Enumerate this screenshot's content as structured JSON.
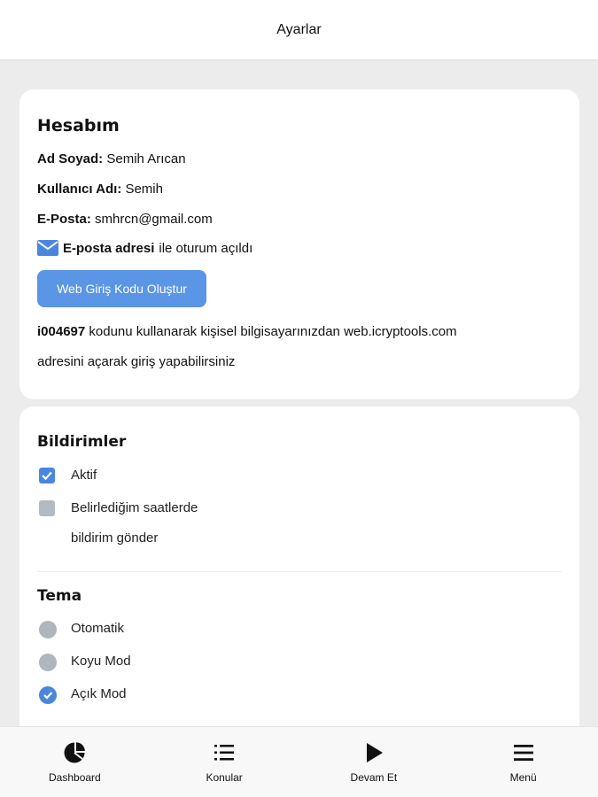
{
  "header": {
    "title": "Ayarlar"
  },
  "account": {
    "title": "Hesabım",
    "name_label": "Ad Soyad:",
    "name_value": "Semih Arıcan",
    "username_label": "Kullanıcı Adı:",
    "username_value": "Semih",
    "email_label": "E-Posta:",
    "email_value": "smhrcn@gmail.com",
    "login_method_bold": "E-posta adresi",
    "login_method_rest": "ile oturum açıldı",
    "web_code_button": "Web Giriş Kodu Oluştur",
    "code": "i004697",
    "code_text_1": "kodunu kullanarak kişisel bilgisayarınızdan web.icryptools.com",
    "code_text_2": "adresini açarak giriş yapabilirsiniz"
  },
  "notifications": {
    "title": "Bildirimler",
    "options": [
      {
        "label": "Aktif",
        "checked": true
      },
      {
        "label_line1": "Belirlediğim saatlerde",
        "label_line2": "bildirim gönder",
        "checked": false
      }
    ]
  },
  "theme": {
    "title": "Tema",
    "options": [
      {
        "label": "Otomatik",
        "selected": false
      },
      {
        "label": "Koyu Mod",
        "selected": false
      },
      {
        "label": "Açık Mod",
        "selected": true
      }
    ]
  },
  "bottom_nav": {
    "items": [
      {
        "label": "Dashboard",
        "icon": "pie-chart-icon"
      },
      {
        "label": "Konular",
        "icon": "list-icon"
      },
      {
        "label": "Devam Et",
        "icon": "play-icon"
      },
      {
        "label": "Menü",
        "icon": "menu-icon"
      }
    ]
  },
  "colors": {
    "accent": "#4a86e0",
    "button": "#5b95e6",
    "background": "#ececec"
  }
}
